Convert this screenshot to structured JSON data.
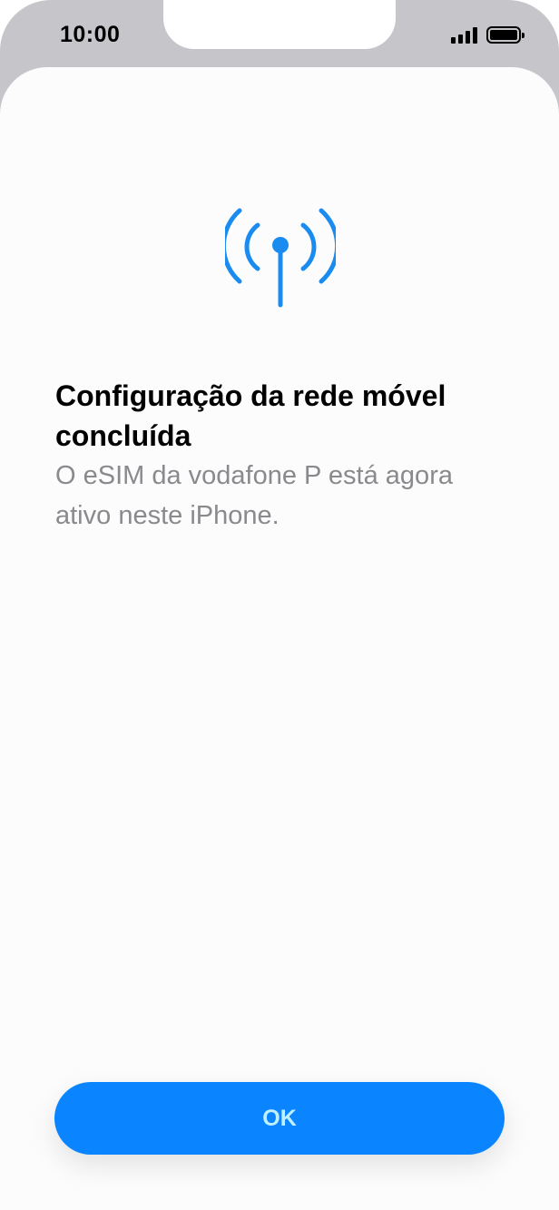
{
  "status_bar": {
    "time": "10:00",
    "signal_icon": "cellular-signal-icon",
    "battery_icon": "battery-icon"
  },
  "main": {
    "icon": "antenna-icon",
    "title": "Configuração da rede móvel concluída",
    "subtitle": "O eSIM da vodafone P está agora ativo neste iPhone."
  },
  "footer": {
    "ok_label": "OK"
  },
  "colors": {
    "accent": "#0a84ff",
    "icon": "#1a8cf0",
    "subtitle": "#8a8a8e",
    "frame": "#c6c6ca"
  }
}
